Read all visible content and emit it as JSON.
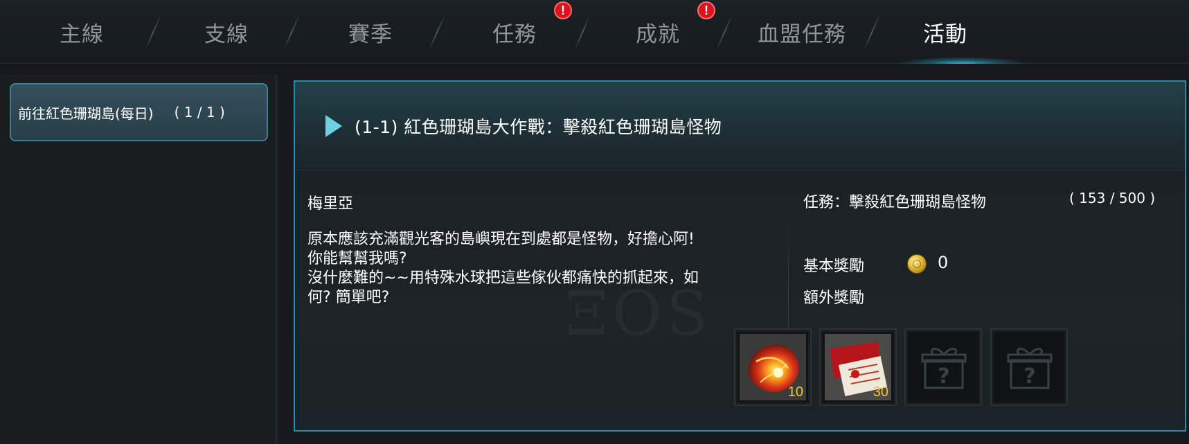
{
  "tabs": [
    {
      "label": "主線",
      "active": false,
      "alert": false
    },
    {
      "label": "支線",
      "active": false,
      "alert": false
    },
    {
      "label": "賽季",
      "active": false,
      "alert": false
    },
    {
      "label": "任務",
      "active": false,
      "alert": true
    },
    {
      "label": "成就",
      "active": false,
      "alert": true
    },
    {
      "label": "血盟任務",
      "active": false,
      "alert": false
    },
    {
      "label": "活動",
      "active": true,
      "alert": false
    }
  ],
  "alert_symbol": "!",
  "sidebar": {
    "items": [
      {
        "label": "前往紅色珊瑚島(每日)",
        "count": "( 1 / 1 )",
        "selected": true
      }
    ]
  },
  "quest": {
    "title": "(1-1) 紅色珊瑚島大作戰：擊殺紅色珊瑚島怪物",
    "npc_name": "梅里亞",
    "dialogue": [
      "原本應該充滿觀光客的島嶼現在到處都是怪物，好擔心阿!",
      "你能幫幫我嗎?",
      "沒什麼難的~~用特殊水球把這些傢伙都痛快的抓起來，如",
      "何? 簡單吧?"
    ],
    "objective_label": "任務：擊殺紅色珊瑚島怪物",
    "objective_progress": "( 153 / 500 )",
    "basic_reward_label": "基本獎勵",
    "basic_reward_value": "0",
    "extra_reward_label": "額外獎勵",
    "rewards": [
      {
        "icon": "red-orb-item-icon",
        "quantity": "10"
      },
      {
        "icon": "red-envelope-item-icon",
        "quantity": "30"
      },
      {
        "icon": "mystery-gift-icon",
        "quantity": ""
      },
      {
        "icon": "mystery-gift-icon",
        "quantity": ""
      }
    ]
  },
  "colors": {
    "accent": "#2a8ba6",
    "active_tab": "#ffffff",
    "inactive_tab": "#8e969c",
    "alert": "#d8141e",
    "quantity": "#f2c43a"
  }
}
